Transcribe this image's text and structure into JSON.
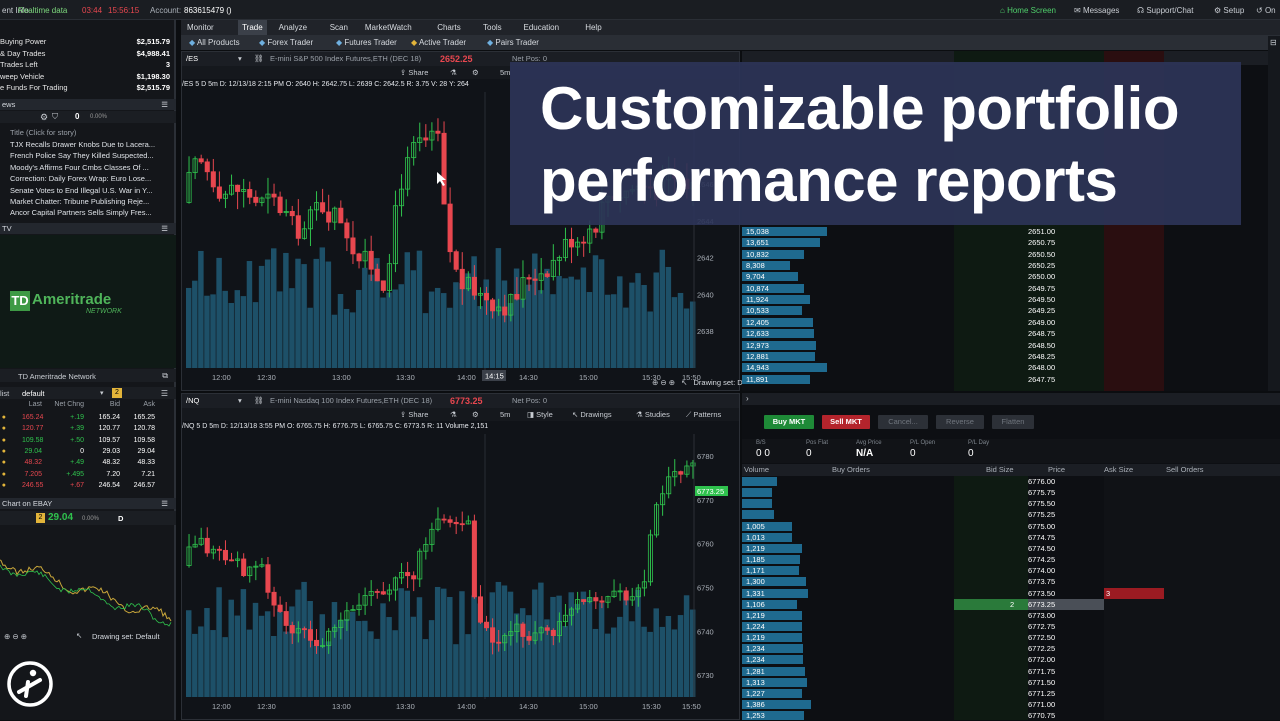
{
  "topbar": {
    "panel_title": "ent Info",
    "realtime_label": "Realtime data",
    "time_red": "03:44",
    "time_clock": "15:56:15",
    "account_label": "Account:",
    "account_number": "863615479 ()",
    "home_screen": "Home Screen",
    "messages": "Messages",
    "support": "Support/Chat",
    "setup": "Setup",
    "on": "On"
  },
  "account_info": [
    {
      "label": "Buying Power",
      "value": "$2,515.79"
    },
    {
      "label": "& Day Trades",
      "value": "$4,988.41"
    },
    {
      "label": "Trades Left",
      "value": "3"
    },
    {
      "label": "weep Vehicle",
      "value": "$1,198.30"
    },
    {
      "label": "e Funds For Trading",
      "value": "$2,515.79"
    }
  ],
  "news": {
    "header": "ews",
    "toolbar_count": "0",
    "pct": "0.00%",
    "title_col": "Title (Click for story)",
    "items": [
      "TJX Recalls Drawer Knobs Due to Lacera...",
      "French Police Say They Killed Suspected...",
      "Moody's Affirms Four Cmbs Classes Of ...",
      "Correction: Daily Forex Wrap: Euro Lose...",
      "Senate Votes to End Illegal U.S. War in Y...",
      "Market Chatter: Tribune Publishing Reje...",
      "Ancor Capital Partners Sells Simply Fres..."
    ]
  },
  "tv": {
    "header": "TV",
    "logo_main": "Ameritrade",
    "logo_sub": "NETWORK",
    "footer_tab": "TD Ameritrade Network"
  },
  "watchlist": {
    "header_left": "list",
    "list_name": "default",
    "columns": [
      "Last",
      "Net Chng",
      "Bid",
      "Ask"
    ],
    "rows": [
      {
        "last": "165.24",
        "chg": "+.19",
        "bid": "165.24",
        "ask": "165.25",
        "lastcolor": "#e8474f",
        "chgcolor": "#2fc24d"
      },
      {
        "last": "120.77",
        "chg": "+.39",
        "bid": "120.77",
        "ask": "120.78",
        "lastcolor": "#e8474f",
        "chgcolor": "#2fc24d"
      },
      {
        "last": "109.58",
        "chg": "+.50",
        "bid": "109.57",
        "ask": "109.58",
        "lastcolor": "#2fc24d",
        "chgcolor": "#2fc24d"
      },
      {
        "last": "29.04",
        "chg": "0",
        "bid": "29.03",
        "ask": "29.04",
        "lastcolor": "#2fc24d",
        "chgcolor": "#ffffff"
      },
      {
        "last": "48.32",
        "chg": "+.49",
        "bid": "48.32",
        "ask": "48.33",
        "lastcolor": "#e8474f",
        "chgcolor": "#2fc24d"
      },
      {
        "last": "7.205",
        "chg": "+.495",
        "bid": "7.20",
        "ask": "7.21",
        "lastcolor": "#e8474f",
        "chgcolor": "#2fc24d"
      },
      {
        "last": "246.55",
        "chg": "+.67",
        "bid": "246.54",
        "ask": "246.57",
        "lastcolor": "#e8474f",
        "chgcolor": "#e8474f"
      }
    ]
  },
  "mini_chart": {
    "header": "Chart on EBAY",
    "price": "29.04",
    "pct": "0.00%",
    "period": "D",
    "drawing_set": "Drawing set: Default"
  },
  "menu": [
    "Monitor",
    "Trade",
    "Analyze",
    "Scan",
    "MarketWatch",
    "Charts",
    "Tools",
    "Education",
    "Help"
  ],
  "trader_tabs": [
    "All Products",
    "Forex Trader",
    "Futures Trader",
    "Active Trader",
    "Pairs Trader"
  ],
  "chart_top": {
    "symbol": "/ES",
    "description": "E-mini S&P 500 Index Futures,ETH (DEC 18)",
    "price": "2652.25",
    "net_pos": "Net Pos: 0",
    "share": "Share",
    "interval": "5m",
    "info": "/ES 5 D 5m   D: 12/13/18 2:15 PM   O: 2640   H: 2642.75   L: 2639   C: 2642.5   R: 3.75   V: 28   Y: 264",
    "drawing_set": "Drawing set: Default",
    "cursor_label": "14:15",
    "x_ticks": [
      "12:00",
      "12:30",
      "13:00",
      "13:30",
      "14:00",
      "14:30",
      "15:00",
      "15:30",
      "15:50"
    ],
    "y_ticks": [
      "2646",
      "2644",
      "2642",
      "2640",
      "2638"
    ]
  },
  "chart_bottom": {
    "symbol": "/NQ",
    "description": "E-mini Nasdaq 100 Index Futures,ETH (DEC 18)",
    "price": "6773.25",
    "net_pos": "Net Pos: 0",
    "share": "Share",
    "interval": "5m",
    "style": "Style",
    "drawings": "Drawings",
    "studies": "Studies",
    "patterns": "Patterns",
    "info": "/NQ 5 D 5m   D: 12/13/18 3:55 PM   O: 6765.75   H: 6776.75   L: 6765.75   C: 6773.5   R: 11   Volume   2,151",
    "last_tag": "6773.25",
    "x_ticks": [
      "12:00",
      "12:30",
      "13:00",
      "13:30",
      "14:00",
      "14:30",
      "15:00",
      "15:30",
      "15:50"
    ],
    "y_ticks": [
      "6780",
      "6770",
      "6760",
      "6750",
      "6740",
      "6730"
    ]
  },
  "ladder_top": {
    "rows": [
      {
        "vol": "15,038",
        "price": "2651.00",
        "w": 0.85
      },
      {
        "vol": "13,651",
        "price": "2650.75",
        "w": 0.78
      },
      {
        "vol": "10,832",
        "price": "2650.50",
        "w": 0.62
      },
      {
        "vol": "8,308",
        "price": "2650.25",
        "w": 0.48
      },
      {
        "vol": "9,704",
        "price": "2650.00",
        "w": 0.56
      },
      {
        "vol": "10,874",
        "price": "2649.75",
        "w": 0.62
      },
      {
        "vol": "11,924",
        "price": "2649.50",
        "w": 0.68
      },
      {
        "vol": "10,533",
        "price": "2649.25",
        "w": 0.6
      },
      {
        "vol": "12,405",
        "price": "2649.00",
        "w": 0.71
      },
      {
        "vol": "12,633",
        "price": "2648.75",
        "w": 0.72
      },
      {
        "vol": "12,973",
        "price": "2648.50",
        "w": 0.74
      },
      {
        "vol": "12,881",
        "price": "2648.25",
        "w": 0.73
      },
      {
        "vol": "14,943",
        "price": "2648.00",
        "w": 0.85
      },
      {
        "vol": "11,891",
        "price": "2647.75",
        "w": 0.68
      }
    ]
  },
  "order_bar": {
    "buy": "Buy MKT",
    "sell": "Sell MKT",
    "cancel": "Cancel...",
    "reverse": "Reverse",
    "flatten": "Flatten"
  },
  "position": {
    "labels": [
      "B/S",
      "Pos Flat",
      "Avg Price",
      "P/L Open",
      "P/L Day"
    ],
    "values": [
      "0  0",
      "0",
      "N/A",
      "0",
      "0"
    ]
  },
  "ladder_bottom": {
    "columns": [
      "Volume",
      "Buy Orders",
      "Bid Size",
      "Price",
      "Ask Size",
      "Sell Orders"
    ],
    "rows": [
      {
        "vol": "",
        "price": "6776.00",
        "w": 0.35
      },
      {
        "vol": "",
        "price": "6775.75",
        "w": 0.3
      },
      {
        "vol": "",
        "price": "6775.50",
        "w": 0.3
      },
      {
        "vol": "",
        "price": "6775.25",
        "w": 0.32
      },
      {
        "vol": "1,005",
        "price": "6775.00",
        "w": 0.5
      },
      {
        "vol": "1,013",
        "price": "6774.75",
        "w": 0.5
      },
      {
        "vol": "1,219",
        "price": "6774.50",
        "w": 0.6
      },
      {
        "vol": "1,185",
        "price": "6774.25",
        "w": 0.58
      },
      {
        "vol": "1,171",
        "price": "6774.00",
        "w": 0.57
      },
      {
        "vol": "1,300",
        "price": "6773.75",
        "w": 0.64
      },
      {
        "vol": "1,331",
        "price": "6773.50",
        "w": 0.66,
        "ask": "3"
      },
      {
        "vol": "1,106",
        "price": "6773.25",
        "w": 0.55,
        "bid": "2",
        "current": true
      },
      {
        "vol": "1,219",
        "price": "6773.00",
        "w": 0.6
      },
      {
        "vol": "1,224",
        "price": "6772.75",
        "w": 0.6
      },
      {
        "vol": "1,219",
        "price": "6772.50",
        "w": 0.6
      },
      {
        "vol": "1,234",
        "price": "6772.25",
        "w": 0.61
      },
      {
        "vol": "1,234",
        "price": "6772.00",
        "w": 0.61
      },
      {
        "vol": "1,281",
        "price": "6771.75",
        "w": 0.63
      },
      {
        "vol": "1,313",
        "price": "6771.50",
        "w": 0.65
      },
      {
        "vol": "1,227",
        "price": "6771.25",
        "w": 0.6
      },
      {
        "vol": "1,386",
        "price": "6771.00",
        "w": 0.69
      },
      {
        "vol": "1,253",
        "price": "6770.75",
        "w": 0.62
      }
    ]
  },
  "overlay": {
    "line1": "Customizable portfolio",
    "line2": "performance reports"
  },
  "colors": {
    "up": "#2fc24d",
    "down": "#e8474f",
    "volume": "#1f5a73",
    "accent": "#3a7bd5"
  }
}
